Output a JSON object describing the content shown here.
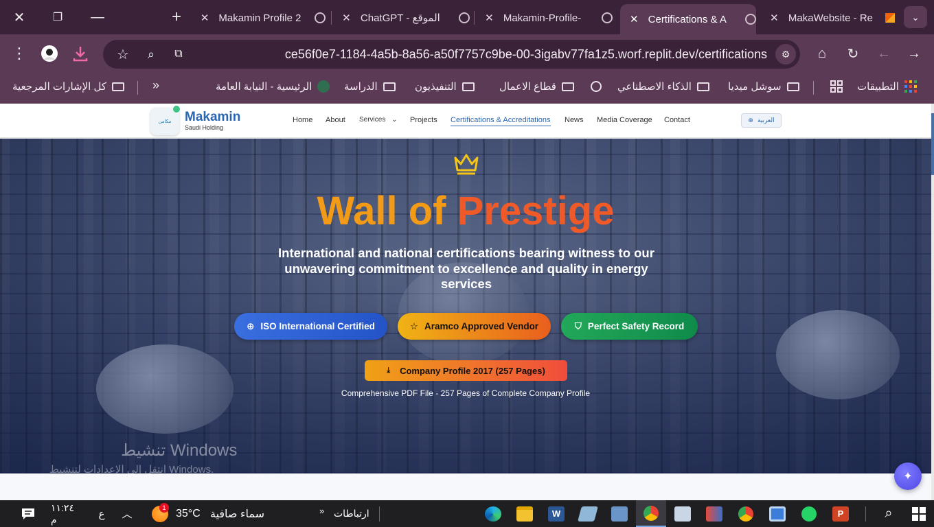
{
  "browser": {
    "tabs": [
      {
        "title": "Makamin Profile 2",
        "active": false
      },
      {
        "title": "ChatGPT - الموقع",
        "active": false
      },
      {
        "title": "Makamin-Profile-",
        "active": false
      },
      {
        "title": "Certifications & A",
        "active": true
      },
      {
        "title": "MakaWebsite - Re",
        "active": false
      }
    ],
    "url": "ce56f0e7-1184-4a5b-8a56-a50f7757c9be-00-3igabv77fa1z5.worf.replit.dev/certifications",
    "bookmarks": {
      "apps": "التطبيقات",
      "items": [
        "سوشل ميديا",
        "الذكاء الاصطناعي",
        "قطاع الاعمال",
        "التنفيذيون",
        "الدراسة",
        "الرئيسية - النيابة العامة"
      ],
      "all_bookmarks": "كل الإشارات المرجعية",
      "more": "»"
    }
  },
  "site": {
    "brand": "Makamin",
    "brand_sub": "Saudi Holding",
    "logo_text": "مكامن",
    "nav": [
      "Home",
      "About",
      "Services",
      "Projects",
      "Certifications & Accreditations",
      "News",
      "Media Coverage",
      "Contact"
    ],
    "lang": "العربية",
    "hero": {
      "title_a": "Wall of ",
      "title_b": "Prestige",
      "subtitle": "International and national certifications bearing witness to our unwavering commitment to excellence and quality in energy services",
      "badges": [
        "ISO International Certified",
        "Aramco Approved Vendor",
        "Perfect Safety Record"
      ],
      "download": "Company Profile 2017 (257 Pages)",
      "download_note": "Comprehensive PDF File - 257 Pages of Complete Company Profile"
    },
    "watermark": {
      "line1": "تنشيط Windows",
      "line2": "انتقل إلى الإعدادات لتنشيط Windows."
    }
  },
  "taskbar": {
    "time": "١١:٢٤ م",
    "lang": "ع",
    "temp": "35°C",
    "weather": "سماء صافية",
    "weather_badge": "1",
    "links": "ارتباطات",
    "links_chevron": "»"
  },
  "colors": {
    "tab_bg": "#3a2238",
    "toolbar": "#5a3a55",
    "accent": "#2a66b0",
    "title_orange": "#f39a17"
  }
}
